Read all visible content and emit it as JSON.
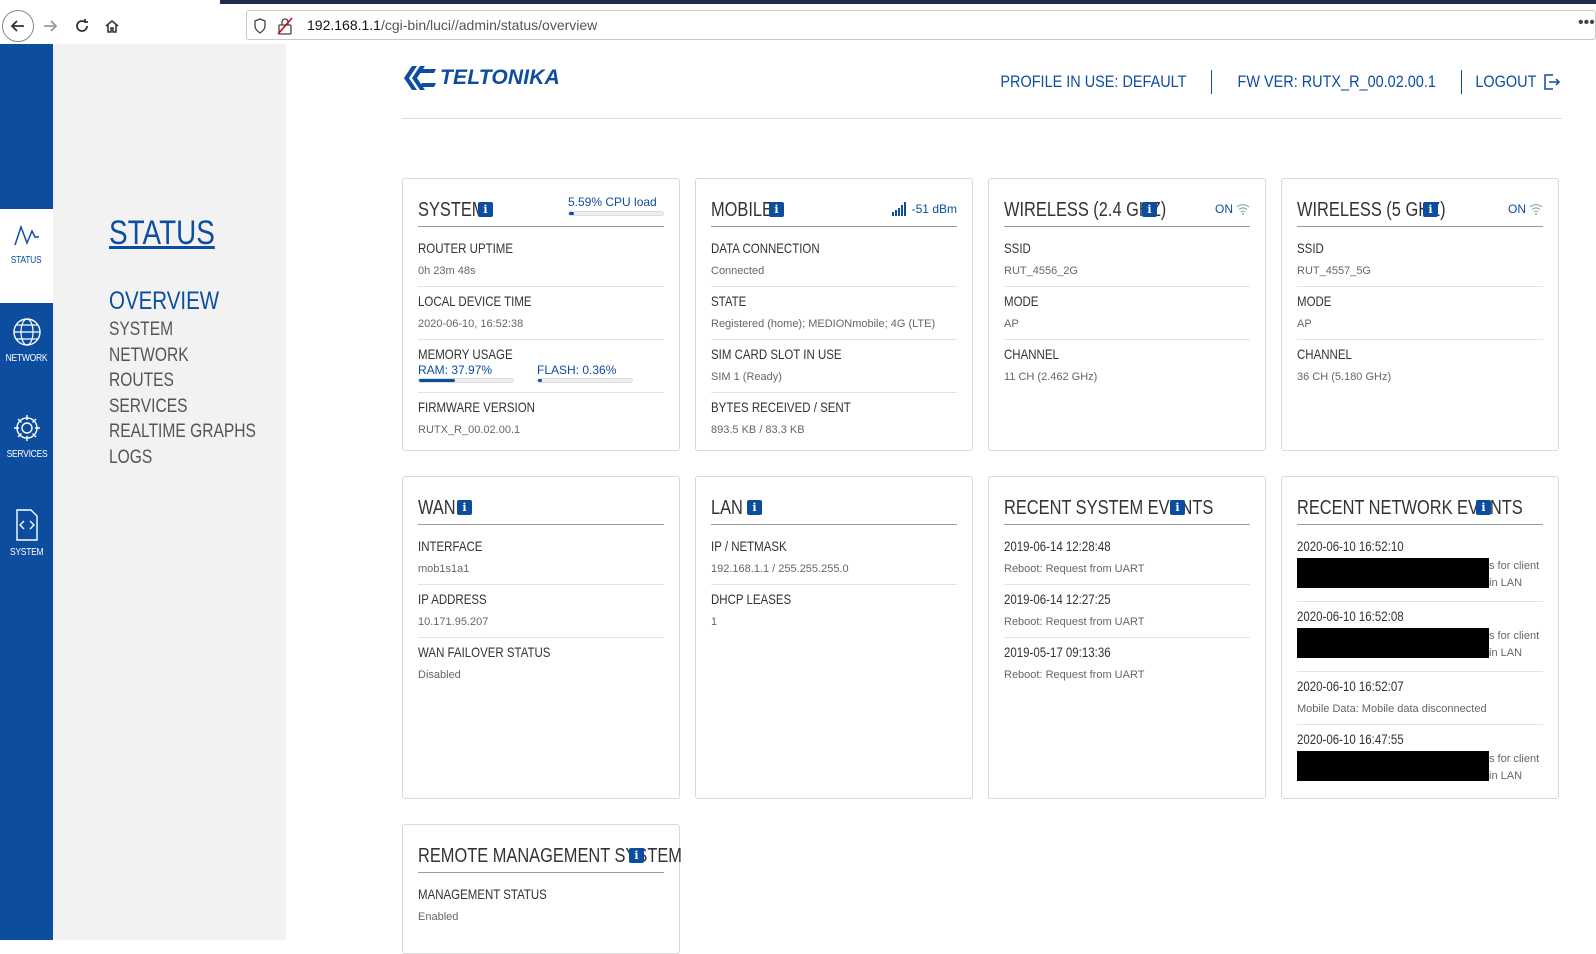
{
  "browser": {
    "url_host": "192.168.1.1",
    "url_path": "/cgi-bin/luci//admin/status/overview"
  },
  "rail": {
    "items": [
      {
        "label": "STATUS",
        "icon": "pulse-icon"
      },
      {
        "label": "NETWORK",
        "icon": "globe-icon"
      },
      {
        "label": "SERVICES",
        "icon": "gear-icon"
      },
      {
        "label": "SYSTEM",
        "icon": "code-file-icon"
      }
    ]
  },
  "menu": {
    "title": "STATUS",
    "items": [
      "OVERVIEW",
      "SYSTEM",
      "NETWORK",
      "ROUTES",
      "SERVICES",
      "REALTIME GRAPHS",
      "LOGS"
    ]
  },
  "header": {
    "logo_text": "TELTONIKA",
    "profile": "PROFILE IN USE: DEFAULT",
    "fw": "FW VER: RUTX_R_00.02.00.1",
    "logout": "LOGOUT"
  },
  "colors": {
    "accent": "#0d4da0"
  },
  "cards": {
    "system": {
      "title": "SYSTEM",
      "cpu_text": "5.59% CPU load",
      "cpu_fraction": 0.0559,
      "rows": [
        {
          "label": "ROUTER UPTIME",
          "value": "0h 23m 48s"
        },
        {
          "label": "LOCAL DEVICE TIME",
          "value": "2020-06-10, 16:52:38"
        },
        {
          "label": "MEMORY USAGE",
          "ram": "RAM: 37.97%",
          "ram_fraction": 0.3797,
          "flash": "FLASH: 0.36%",
          "flash_fraction": 0.0036
        },
        {
          "label": "FIRMWARE VERSION",
          "value": "RUTX_R_00.02.00.1"
        }
      ]
    },
    "mobile": {
      "title": "MOBILE",
      "signal": "-51 dBm",
      "rows": [
        {
          "label": "DATA CONNECTION",
          "value": "Connected"
        },
        {
          "label": "STATE",
          "value": "Registered (home); MEDIONmobile; 4G (LTE)"
        },
        {
          "label": "SIM CARD SLOT IN USE",
          "value": "SIM 1 (Ready)"
        },
        {
          "label": "BYTES RECEIVED / SENT",
          "value": "893.5 KB / 83.3 KB"
        }
      ]
    },
    "wireless24": {
      "title": "WIRELESS (2.4 GHZ)",
      "state": "ON",
      "rows": [
        {
          "label": "SSID",
          "value": "RUT_4556_2G"
        },
        {
          "label": "MODE",
          "value": "AP"
        },
        {
          "label": "CHANNEL",
          "value": "11 CH (2.462 GHz)"
        }
      ]
    },
    "wireless5": {
      "title": "WIRELESS (5 GHZ)",
      "state": "ON",
      "rows": [
        {
          "label": "SSID",
          "value": "RUT_4557_5G"
        },
        {
          "label": "MODE",
          "value": "AP"
        },
        {
          "label": "CHANNEL",
          "value": "36 CH (5.180 GHz)"
        }
      ]
    },
    "wan": {
      "title": "WAN",
      "rows": [
        {
          "label": "INTERFACE",
          "value": "mob1s1a1"
        },
        {
          "label": "IP ADDRESS",
          "value": "10.171.95.207"
        },
        {
          "label": "WAN FAILOVER STATUS",
          "value": "Disabled"
        }
      ]
    },
    "lan": {
      "title": "LAN",
      "rows": [
        {
          "label": "IP / NETMASK",
          "value": "192.168.1.1 / 255.255.255.0"
        },
        {
          "label": "DHCP LEASES",
          "value": "1"
        }
      ]
    },
    "sys_events": {
      "title": "RECENT SYSTEM EVENTS",
      "rows": [
        {
          "date": "2019-06-14 12:28:48",
          "value": "Reboot: Request from UART"
        },
        {
          "date": "2019-06-14 12:27:25",
          "value": "Reboot: Request from UART"
        },
        {
          "date": "2019-05-17 09:13:36",
          "value": "Reboot: Request from UART"
        }
      ]
    },
    "net_events": {
      "title": "RECENT NETWORK EVENTS",
      "rows": [
        {
          "date": "2020-06-10 16:52:10",
          "tail1": "s for client",
          "tail2": "in LAN"
        },
        {
          "date": "2020-06-10 16:52:08",
          "tail1": "s for client",
          "tail2": "in LAN"
        },
        {
          "date": "2020-06-10 16:52:07",
          "value": "Mobile Data: Mobile data disconnected"
        },
        {
          "date": "2020-06-10 16:47:55",
          "tail1": "s for client",
          "tail2": "in LAN"
        }
      ]
    },
    "rms": {
      "title": "REMOTE MANAGEMENT SYSTEM",
      "rows": [
        {
          "label": "MANAGEMENT STATUS",
          "value": "Enabled"
        }
      ]
    }
  }
}
